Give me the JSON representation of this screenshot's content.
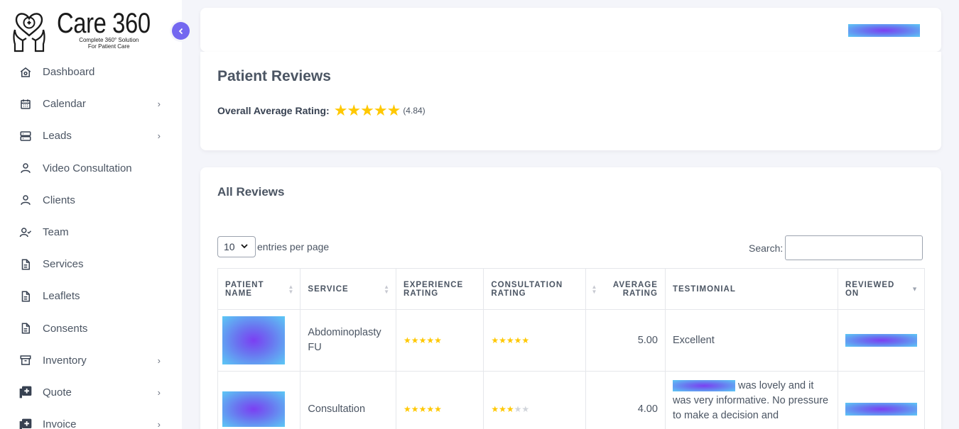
{
  "app": {
    "logo_title": "Care 360",
    "logo_sub_line1": "Complete 360° Solution",
    "logo_sub_line2": "For Patient Care"
  },
  "sidebar": {
    "items": [
      {
        "label": "Dashboard",
        "icon": "home-icon",
        "has_submenu": false
      },
      {
        "label": "Calendar",
        "icon": "calendar-icon",
        "has_submenu": true
      },
      {
        "label": "Leads",
        "icon": "server-icon",
        "has_submenu": true
      },
      {
        "label": "Video Consultation",
        "icon": "user-icon",
        "has_submenu": false
      },
      {
        "label": "Clients",
        "icon": "user-icon",
        "has_submenu": false
      },
      {
        "label": "Team",
        "icon": "user-check-icon",
        "has_submenu": false
      },
      {
        "label": "Services",
        "icon": "document-icon",
        "has_submenu": false
      },
      {
        "label": "Leaflets",
        "icon": "document-icon",
        "has_submenu": false
      },
      {
        "label": "Consents",
        "icon": "document-icon",
        "has_submenu": false
      },
      {
        "label": "Inventory",
        "icon": "archive-icon",
        "has_submenu": true
      },
      {
        "label": "Quote",
        "icon": "plus-square-icon",
        "has_submenu": true
      },
      {
        "label": "Invoice",
        "icon": "plus-square-icon",
        "has_submenu": true
      }
    ],
    "chevron": "›"
  },
  "ratings": {
    "title": "Patient Reviews",
    "overall_label": "Overall Average Rating:",
    "stars": "★★★★★",
    "overall_value": "(4.84)"
  },
  "reviews": {
    "title": "All Reviews",
    "entries_value": "10",
    "entries_label": "entries per page",
    "search_label": "Search:",
    "columns": [
      {
        "line1": "PATIENT",
        "line2": "NAME"
      },
      {
        "line1": "SERVICE",
        "line2": ""
      },
      {
        "line1": "EXPERIENCE",
        "line2": "RATING"
      },
      {
        "line1": "CONSULTATION",
        "line2": "RATING"
      },
      {
        "line1": "AVERAGE",
        "line2": "RATING"
      },
      {
        "line1": "TESTIMONIAL",
        "line2": ""
      },
      {
        "line1": "REVIEWED",
        "line2": "ON"
      }
    ],
    "rows": [
      {
        "service": "Abdominoplasty FU",
        "experience_rating": 5,
        "consultation_rating": 5,
        "average_rating": "5.00",
        "testimonial": "Excellent"
      },
      {
        "service": "Consultation",
        "experience_rating": 5,
        "consultation_rating": 3,
        "average_rating": "4.00",
        "testimonial_after_name": " was lovely and it was very informative. No pressure to make a decision and"
      }
    ]
  },
  "colors": {
    "accent": "#7367f0",
    "star": "#ffc800",
    "star_off": "#d1d5db"
  }
}
